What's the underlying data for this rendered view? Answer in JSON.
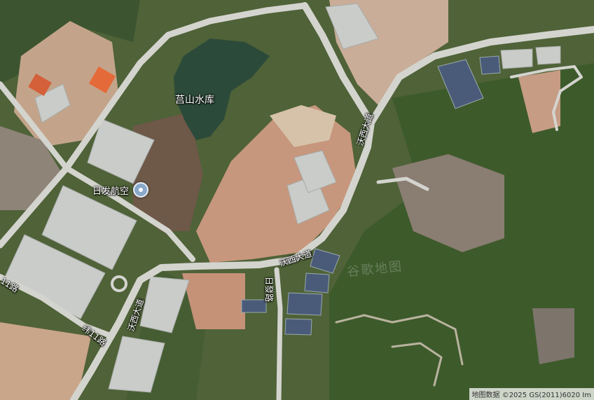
{
  "map": {
    "water_body": "莒山水库",
    "poi": "日发航空",
    "roads": {
      "woxi_upper": "沃西大道",
      "woxi_middle": "沃西大道",
      "woxi_lower": "沃西大道",
      "rifa_road": "日發路",
      "wei11_upper": "纬11路",
      "wei11_left": "11路"
    },
    "watermark": "谷歌地图",
    "attribution": "地图数据 ©2025 GS(2011)6020 Im"
  },
  "colors": {
    "road": "#d4d4cf",
    "water": "#2c4a3a",
    "vegetation": "#3f5a2e",
    "bare_earth": "#c69a80"
  }
}
